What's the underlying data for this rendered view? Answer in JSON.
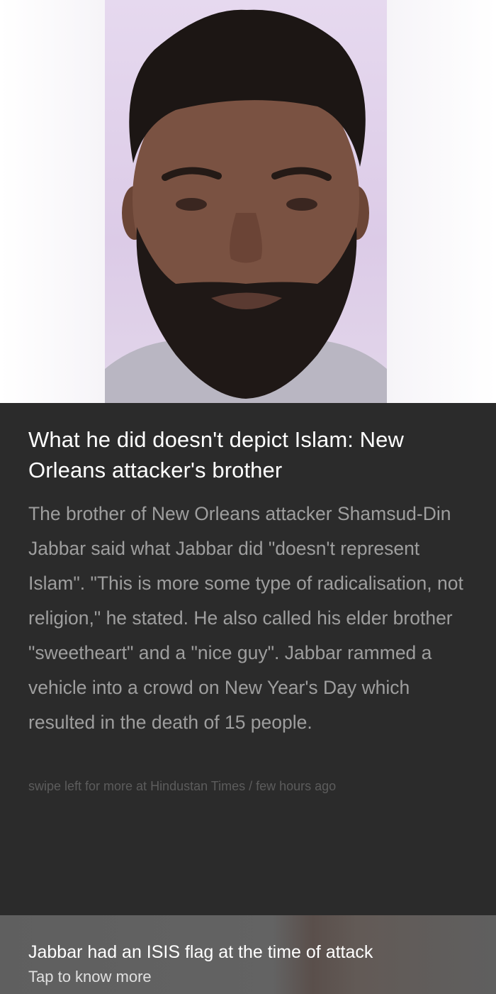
{
  "story": {
    "headline": "What he did doesn't depict Islam: New Orleans attacker's brother",
    "body": "The brother of New Orleans attacker Shamsud-Din Jabbar said what Jabbar did \"doesn't represent Islam\". \"This is more some type of radicalisation, not religion,\" he stated. He also called his elder brother \"sweetheart\" and a \"nice guy\". Jabbar rammed a vehicle into a crowd on New Year's Day which resulted in the death of 15 people.",
    "source": "swipe left for more at Hindustan Times / few hours ago"
  },
  "next_story": {
    "title": "Jabbar had an ISIS flag at the time of attack",
    "cta": "Tap to know more"
  }
}
